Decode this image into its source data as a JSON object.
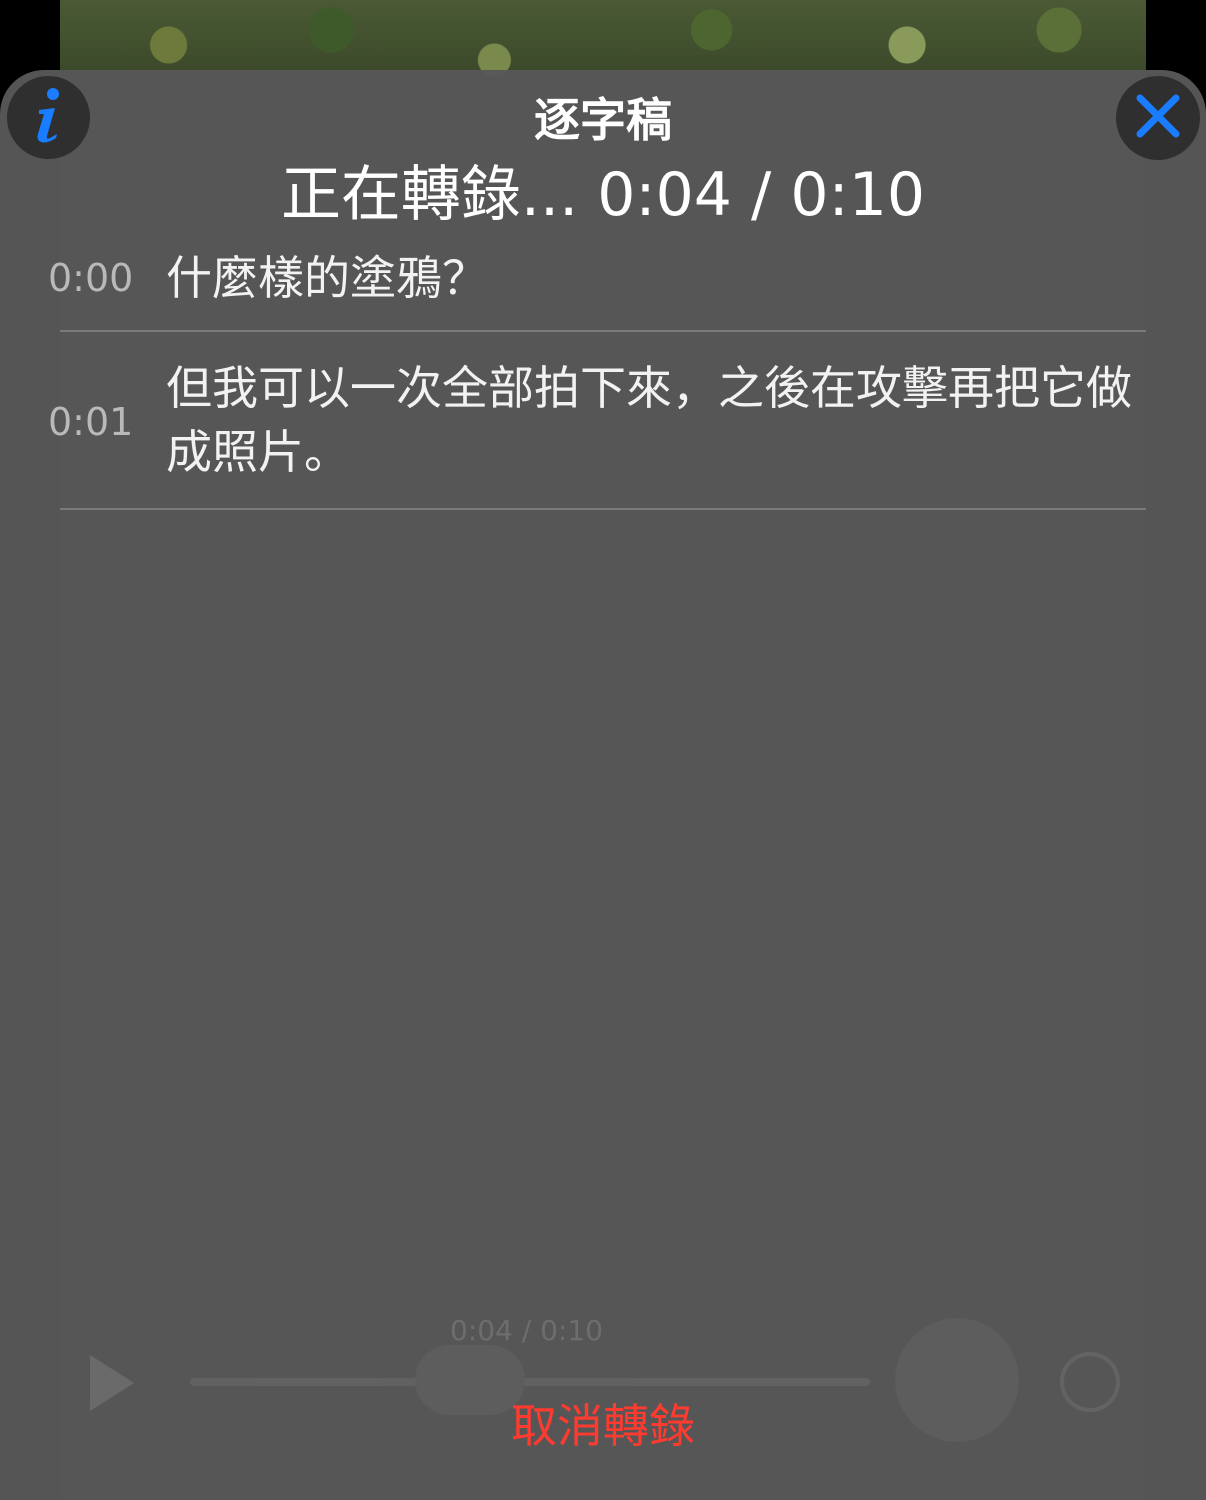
{
  "header": {
    "title": "逐字稿",
    "status": "正在轉錄... 0:04 / 0:10"
  },
  "transcript": [
    {
      "time": "0:00",
      "text": "什麼樣的塗鴉？"
    },
    {
      "time": "0:01",
      "text": "但我可以一次全部拍下來，之後在攻擊再把它做成照片。"
    }
  ],
  "background_player": {
    "time_readout": "0:04 / 0:10"
  },
  "actions": {
    "cancel_label": "取消轉錄"
  },
  "icons": {
    "info": "info-icon",
    "close": "close-icon",
    "play": "play-icon",
    "airplay": "airplay-icon"
  },
  "colors": {
    "accent": "#1a7cff",
    "cancel": "#ff3b30"
  }
}
